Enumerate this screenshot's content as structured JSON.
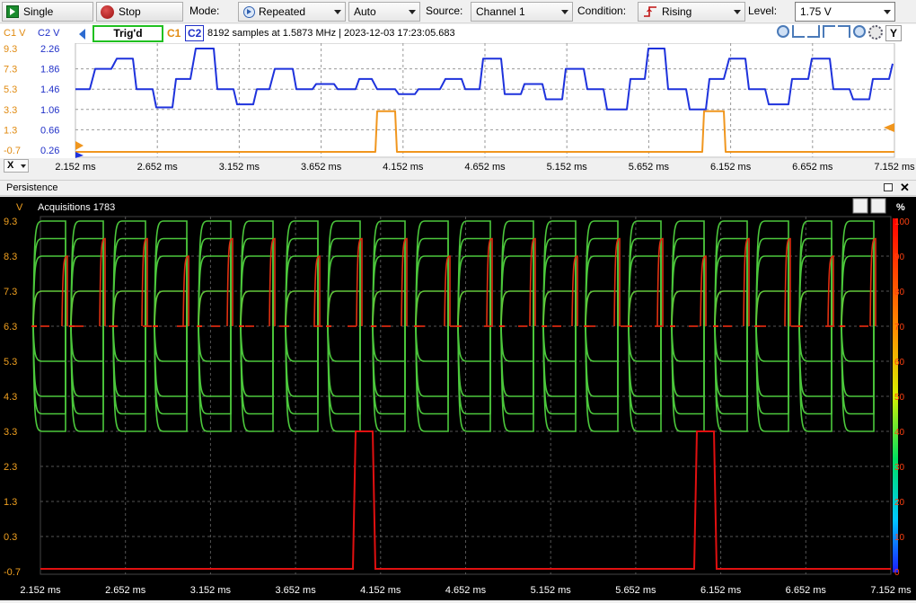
{
  "toolbar": {
    "single_label": "Single",
    "stop_label": "Stop",
    "mode_label": "Mode:",
    "mode_value": "Repeated",
    "auto_value": "Auto",
    "source_label": "Source:",
    "source_value": "Channel 1",
    "condition_label": "Condition:",
    "condition_value": "Rising",
    "level_label": "Level:",
    "level_value": "1.75 V"
  },
  "infobar": {
    "c1_units": "C1 V",
    "c2_units": "C2 V",
    "trig_status": "Trig'd",
    "c1_tag": "C1",
    "c2_tag": "C2",
    "info": "8192 samples at 1.5873 MHz | 2023-12-03 17:23:05.683"
  },
  "scope": {
    "c1_ticks": [
      "9.3",
      "7.3",
      "5.3",
      "3.3",
      "1.3",
      "-0.7"
    ],
    "c2_ticks": [
      "2.26",
      "1.86",
      "1.46",
      "1.06",
      "0.66",
      "0.26"
    ],
    "x_button": "X",
    "x_ticks": [
      "2.152 ms",
      "2.652 ms",
      "3.152 ms",
      "3.652 ms",
      "4.152 ms",
      "4.652 ms",
      "5.152 ms",
      "5.652 ms",
      "6.152 ms",
      "6.652 ms",
      "7.152 ms"
    ],
    "c1_color": "#f0961e",
    "c2_color": "#1e32dc"
  },
  "persistence": {
    "title": "Persistence",
    "acquisitions": "Acquisitions 1783",
    "y_unit": "V",
    "y_ticks": [
      "9.3",
      "8.3",
      "7.3",
      "6.3",
      "5.3",
      "4.3",
      "3.3",
      "2.3",
      "1.3",
      "0.3",
      "-0.7"
    ],
    "pct_unit": "%",
    "pct_ticks": [
      "100",
      "90",
      "80",
      "70",
      "60",
      "50",
      "40",
      "30",
      "20",
      "10",
      "0"
    ],
    "x_ticks": [
      "2.152 ms",
      "2.652 ms",
      "3.152 ms",
      "3.652 ms",
      "4.152 ms",
      "4.652 ms",
      "5.152 ms",
      "5.652 ms",
      "6.152 ms",
      "6.652 ms",
      "7.152 ms"
    ]
  }
}
